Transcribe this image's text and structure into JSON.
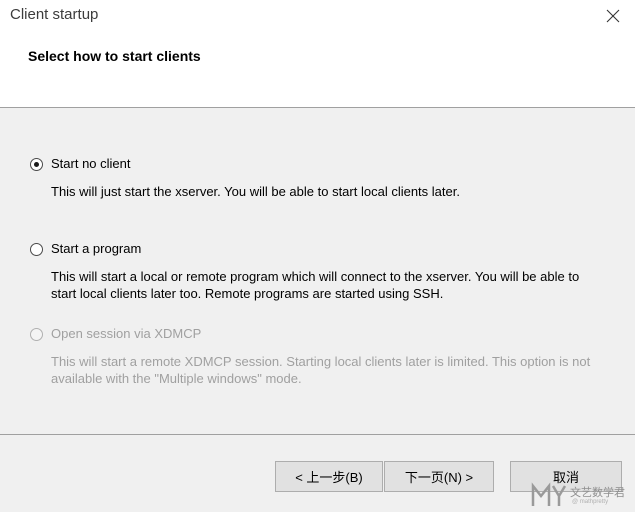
{
  "window": {
    "title": "Client startup",
    "close_icon": "close-icon"
  },
  "header": {
    "title": "Select how to start clients"
  },
  "options": [
    {
      "label": "Start no client",
      "description": "This will just start the xserver. You will be able to start local clients later.",
      "selected": true,
      "enabled": true
    },
    {
      "label": "Start a program",
      "description": "This will start a local or remote program which will connect to the xserver. You will be able to start local clients later too. Remote programs are started using SSH.",
      "selected": false,
      "enabled": true
    },
    {
      "label": "Open session via XDMCP",
      "description": "This will start a remote XDMCP session. Starting local clients later is limited. This option is not available with the \"Multiple windows\" mode.",
      "selected": false,
      "enabled": false
    }
  ],
  "buttons": {
    "back": "< 上一步(B)",
    "next": "下一页(N) >",
    "cancel": "取消"
  },
  "watermark": {
    "text": "文艺数学君",
    "sub": "@ mathpretty"
  }
}
